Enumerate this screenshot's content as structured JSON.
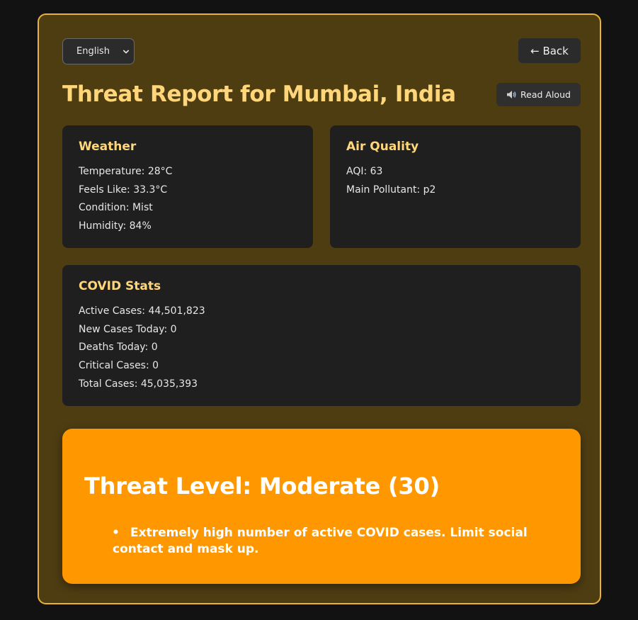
{
  "header": {
    "language": {
      "selected": "English",
      "options": [
        "English"
      ]
    },
    "back_label": "← Back",
    "read_aloud_label": "Read Aloud",
    "title": "Threat Report for Mumbai, India"
  },
  "weather": {
    "heading": "Weather",
    "lines": [
      "Temperature: 28°C",
      "Feels Like: 33.3°C",
      "Condition: Mist",
      "Humidity: 84%"
    ]
  },
  "air_quality": {
    "heading": "Air Quality",
    "lines": [
      "AQI: 63",
      "Main Pollutant: p2"
    ]
  },
  "covid": {
    "heading": "COVID Stats",
    "lines": [
      "Active Cases: 44,501,823",
      "New Cases Today: 0",
      "Deaths Today: 0",
      "Critical Cases: 0",
      "Total Cases: 45,035,393"
    ]
  },
  "threat": {
    "heading": "Threat Level: Moderate (30)",
    "items": [
      "Extremely high number of active COVID cases. Limit social contact and mask up."
    ]
  },
  "colors": {
    "accent": "#ffd77a",
    "frame_border": "#e8b33a",
    "frame_background": "#4f3d12",
    "card_background": "#1f1f1f",
    "threat_background": "#ff9800"
  },
  "icons": {
    "read_aloud": "speaker-icon",
    "language_dropdown": "chevron-down-icon"
  }
}
